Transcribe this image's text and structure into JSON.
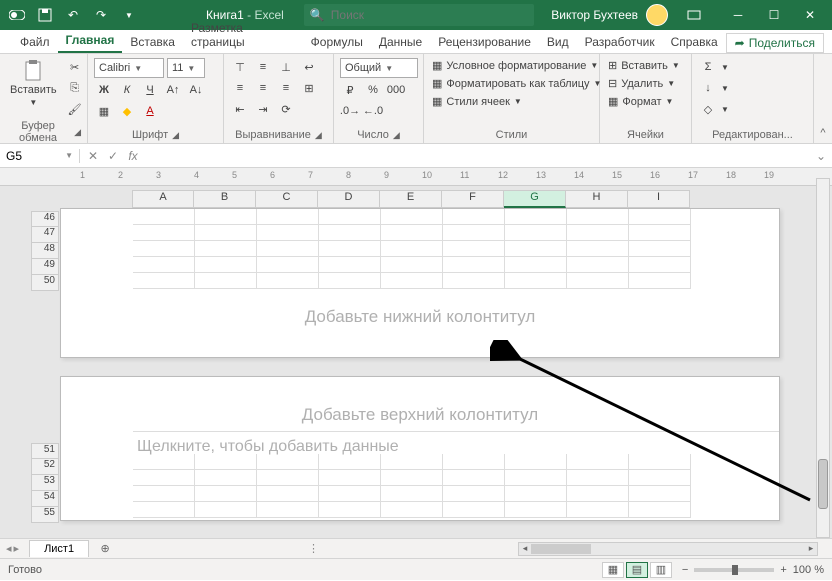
{
  "titlebar": {
    "doc_name": "Книга1",
    "app_name": "Excel",
    "search_placeholder": "Поиск",
    "user_name": "Виктор Бухтеев"
  },
  "tabs": {
    "items": [
      "Файл",
      "Главная",
      "Вставка",
      "Разметка страницы",
      "Формулы",
      "Данные",
      "Рецензирование",
      "Вид",
      "Разработчик",
      "Справка"
    ],
    "active_index": 1,
    "share": "Поделиться"
  },
  "ribbon": {
    "clipboard": {
      "paste": "Вставить",
      "label": "Буфер обмена"
    },
    "font": {
      "name": "Calibri",
      "size": "11",
      "label": "Шрифт"
    },
    "align": {
      "label": "Выравнивание"
    },
    "number": {
      "format": "Общий",
      "label": "Число"
    },
    "styles": {
      "cond": "Условное форматирование",
      "table": "Форматировать как таблицу",
      "cell": "Стили ячеек",
      "label": "Стили"
    },
    "cells": {
      "insert": "Вставить",
      "delete": "Удалить",
      "format": "Формат",
      "label": "Ячейки"
    },
    "editing": {
      "label": "Редактирован..."
    }
  },
  "formula_bar": {
    "name_box": "G5",
    "formula": ""
  },
  "grid": {
    "columns": [
      "A",
      "B",
      "C",
      "D",
      "E",
      "F",
      "G",
      "H",
      "I"
    ],
    "active_col": "G",
    "page1_rows": [
      "46",
      "47",
      "48",
      "49",
      "50"
    ],
    "page2_rows": [
      "51",
      "52",
      "53",
      "54",
      "55"
    ],
    "footer_prompt": "Добавьте нижний колонтитул",
    "header_prompt": "Добавьте верхний колонтитул",
    "data_prompt": "Щелкните, чтобы добавить данные",
    "ruler_ticks": [
      "1",
      "2",
      "3",
      "4",
      "5",
      "6",
      "7",
      "8",
      "9",
      "10",
      "11",
      "12",
      "13",
      "14",
      "15",
      "16",
      "17",
      "18",
      "19"
    ]
  },
  "sheets": {
    "active": "Лист1"
  },
  "status": {
    "ready": "Готово",
    "zoom": "100 %"
  }
}
